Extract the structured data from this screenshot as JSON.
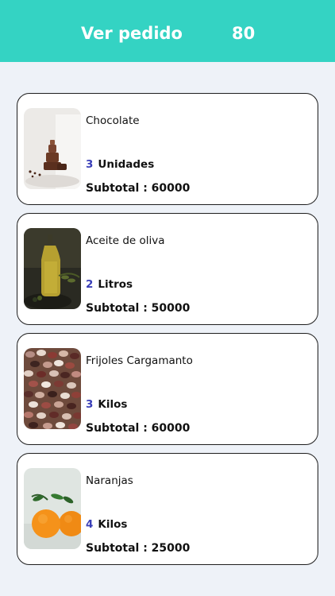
{
  "header": {
    "title": "Ver pedido",
    "count": "80",
    "bg_color": "#34d3c3"
  },
  "subtotal_label": "Subtotal : ",
  "order_items": [
    {
      "name": "Chocolate",
      "quantity": "3",
      "unit": "Unidades",
      "subtotal": "60000",
      "image_icon": "chocolate-photo"
    },
    {
      "name": "Aceite de oliva",
      "quantity": "2",
      "unit": "Litros",
      "subtotal": "50000",
      "image_icon": "olive-oil-photo"
    },
    {
      "name": "Frijoles Cargamanto",
      "quantity": "3",
      "unit": "Kilos",
      "subtotal": "60000",
      "image_icon": "beans-photo"
    },
    {
      "name": "Naranjas",
      "quantity": "4",
      "unit": "Kilos",
      "subtotal": "25000",
      "image_icon": "oranges-photo"
    }
  ]
}
